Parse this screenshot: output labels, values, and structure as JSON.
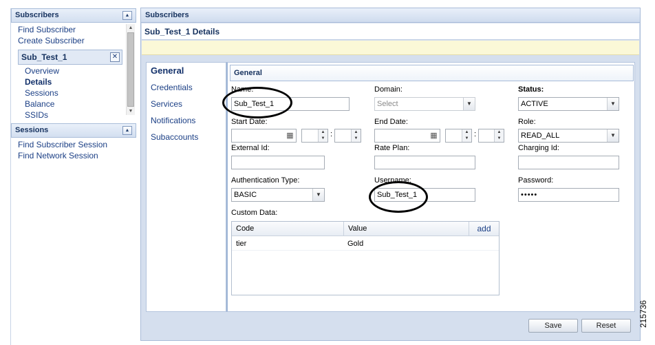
{
  "nav": {
    "subscribers_title": "Subscribers",
    "find_subscriber": "Find Subscriber",
    "create_subscriber": "Create Subscriber",
    "subscriber_name": "Sub_Test_1",
    "items": [
      "Overview",
      "Details",
      "Sessions",
      "Balance",
      "SSIDs"
    ],
    "sessions_title": "Sessions",
    "find_subscriber_session": "Find Subscriber Session",
    "find_network_session": "Find Network Session"
  },
  "main": {
    "header": "Subscribers",
    "title": "Sub_Test_1 Details",
    "tabs": [
      "General",
      "Credentials",
      "Services",
      "Notifications",
      "Subaccounts"
    ]
  },
  "general": {
    "section_title": "General",
    "name_label": "Name:",
    "name_value": "Sub_Test_1",
    "domain_label": "Domain:",
    "domain_placeholder": "Select",
    "status_label": "Status:",
    "status_value": "ACTIVE",
    "start_date_label": "Start Date:",
    "end_date_label": "End Date:",
    "role_label": "Role:",
    "role_value": "READ_ALL",
    "external_id_label": "External Id:",
    "rate_plan_label": "Rate Plan:",
    "charging_id_label": "Charging Id:",
    "auth_type_label": "Authentication Type:",
    "auth_type_value": "BASIC",
    "username_label": "Username:",
    "username_value": "Sub_Test_1",
    "password_label": "Password:",
    "password_value": "•••••",
    "custom_data_label": "Custom Data:",
    "custom_data": {
      "columns": [
        "Code",
        "Value"
      ],
      "add_label": "add",
      "rows": [
        {
          "code": "tier",
          "value": "Gold"
        }
      ]
    }
  },
  "buttons": {
    "save": "Save",
    "reset": "Reset"
  },
  "figure_id": "215736",
  "icons": {
    "collapse": "collapse-up-icon",
    "close": "close-icon",
    "dropdown": "chevron-down-icon",
    "calendar": "calendar-icon",
    "spinner": "spinner-icon"
  }
}
